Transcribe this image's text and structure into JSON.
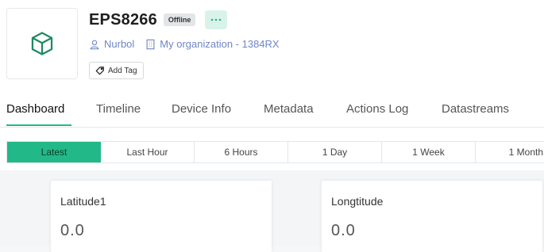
{
  "device": {
    "name": "EPS8266",
    "status": "Offline",
    "owner": "Nurbol",
    "organization": "My organization - 1384RX",
    "add_tag_label": "Add Tag",
    "more_label": "•••"
  },
  "tabs": [
    {
      "label": "Dashboard",
      "active": true
    },
    {
      "label": "Timeline",
      "active": false
    },
    {
      "label": "Device Info",
      "active": false
    },
    {
      "label": "Metadata",
      "active": false
    },
    {
      "label": "Actions Log",
      "active": false
    },
    {
      "label": "Datastreams",
      "active": false
    }
  ],
  "time_ranges": [
    {
      "label": "Latest",
      "active": true
    },
    {
      "label": "Last Hour",
      "active": false
    },
    {
      "label": "6 Hours",
      "active": false
    },
    {
      "label": "1 Day",
      "active": false
    },
    {
      "label": "1 Week",
      "active": false
    },
    {
      "label": "1 Month",
      "active": false
    }
  ],
  "widgets": [
    {
      "label": "Latitude1",
      "value": "0.0"
    },
    {
      "label": "Longtitude",
      "value": "0.0"
    }
  ],
  "colors": {
    "accent": "#23b887",
    "link": "#6f87c9",
    "badge_bg": "#e3e5e8"
  },
  "icons": {
    "device": "cube-icon",
    "owner": "user-icon",
    "organization": "building-icon",
    "tag": "tag-icon",
    "more": "more-dots-icon"
  }
}
